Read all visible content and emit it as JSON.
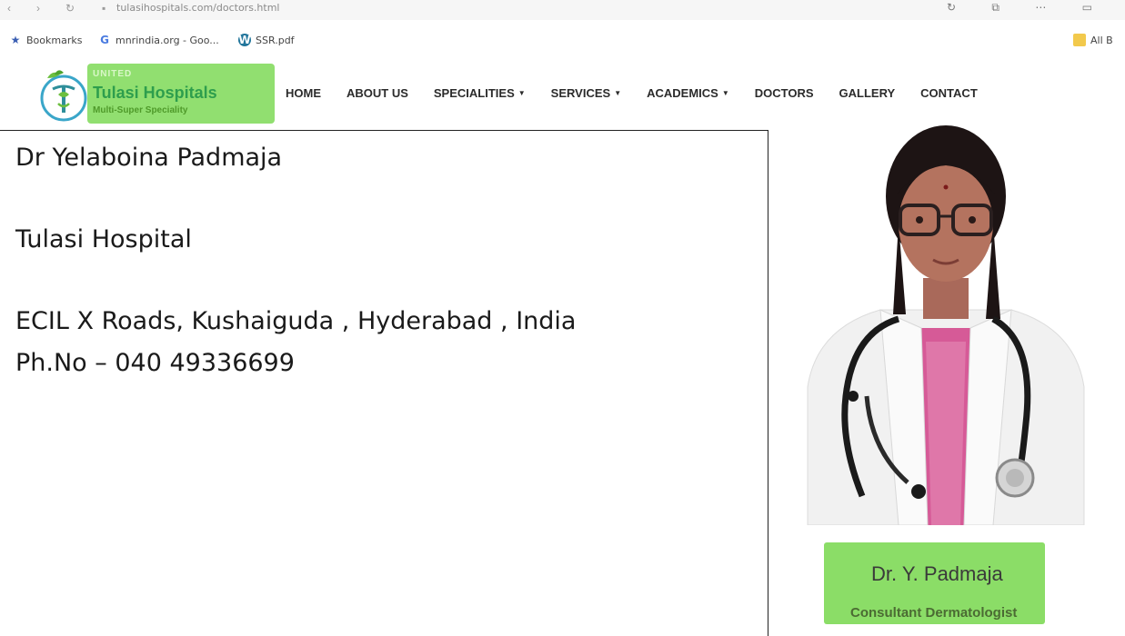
{
  "browser": {
    "url_fragment": "tulasihospitals.com/doctors.html",
    "bookmarks": [
      {
        "icon": "star-icon",
        "label": "Bookmarks"
      },
      {
        "icon": "google-icon",
        "label": "mnrindia.org - Goo..."
      },
      {
        "icon": "wordpress-icon",
        "label": "SSR.pdf"
      }
    ],
    "all_bookmarks_label": "All B"
  },
  "site": {
    "logo": {
      "small": "UNITED",
      "name": "Tulasi Hospitals",
      "tagline": "Multi-Super Speciality"
    },
    "nav": [
      {
        "label": "HOME",
        "has_dropdown": false
      },
      {
        "label": "ABOUT US",
        "has_dropdown": false
      },
      {
        "label": "SPECIALITIES",
        "has_dropdown": true
      },
      {
        "label": "SERVICES",
        "has_dropdown": true
      },
      {
        "label": "ACADEMICS",
        "has_dropdown": true
      },
      {
        "label": "DOCTORS",
        "has_dropdown": false
      },
      {
        "label": "GALLERY",
        "has_dropdown": false
      },
      {
        "label": "CONTACT",
        "has_dropdown": false
      }
    ]
  },
  "doctor": {
    "full_name": "Dr Yelaboina Padmaja",
    "hospital": "Tulasi Hospital",
    "address": "ECIL X Roads, Kushaiguda , Hyderabad , India",
    "phone": "Ph.No – 040 49336699",
    "badge_name": "Dr. Y. Padmaja",
    "badge_title": "Consultant Dermatologist"
  },
  "colors": {
    "highlight": "#7ed957",
    "nav_text": "#2b2b2b",
    "coat": "#f4f4f4"
  }
}
